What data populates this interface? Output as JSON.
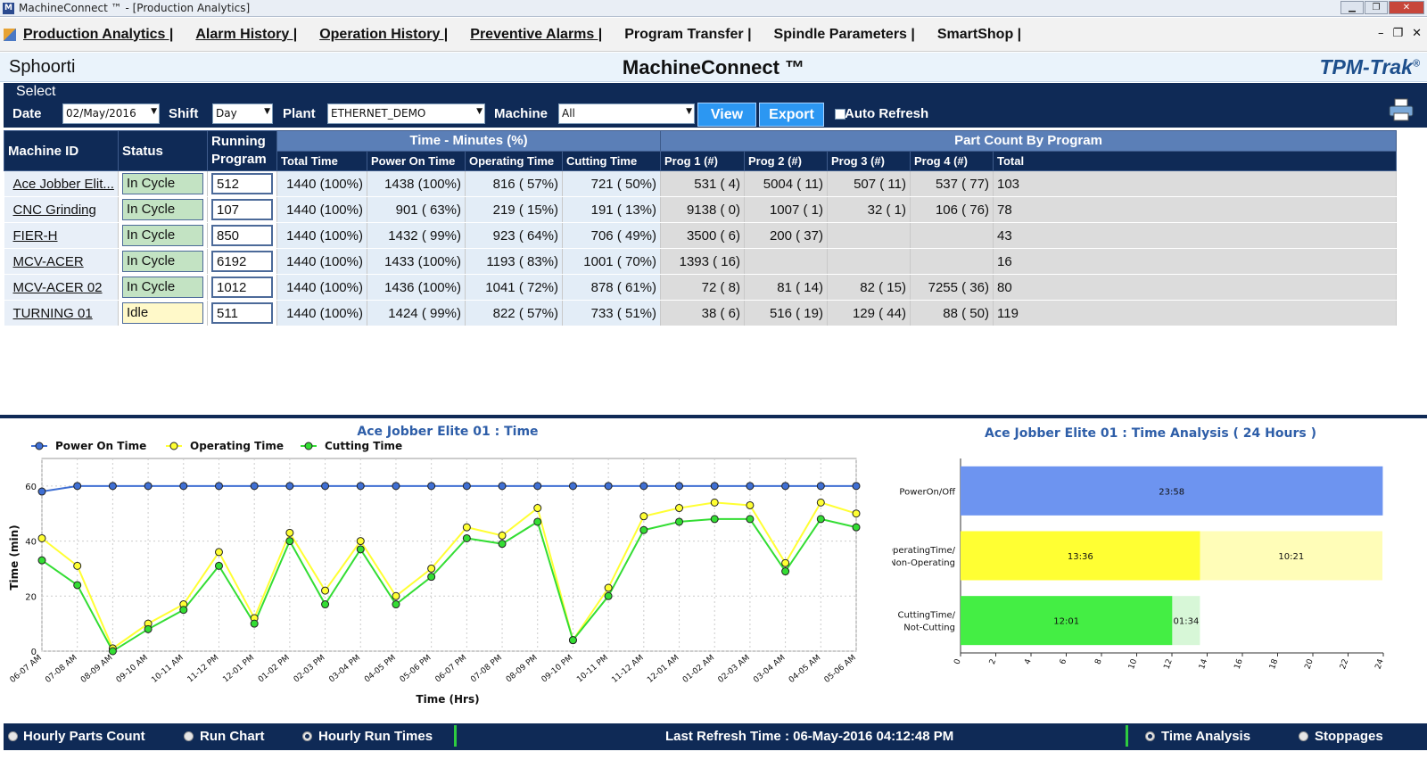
{
  "window": {
    "title": "MachineConnect ™ - [Production Analytics]",
    "app_icon_letter": "M",
    "min_label": "▁",
    "max_label": "❐",
    "close_label": "✕"
  },
  "menu": {
    "items": [
      "Production Analytics |",
      "Alarm History |",
      "Operation History |",
      "Preventive Alarms |",
      "Program Transfer |",
      "Spindle Parameters |",
      "SmartShop |"
    ],
    "mdi_min": "–",
    "mdi_restore": "❐",
    "mdi_close": "✕"
  },
  "header": {
    "company": "Sphoorti",
    "title": "MachineConnect ™",
    "brand": "TPM-Trak",
    "brand_reg": "®"
  },
  "select": {
    "legend": "Select",
    "date_label": "Date",
    "date_value": "02/May/2016",
    "shift_label": "Shift",
    "shift_value": "Day",
    "plant_label": "Plant",
    "plant_value": "ETHERNET_DEMO",
    "machine_label": "Machine",
    "machine_value": "All",
    "view_label": "View",
    "export_label": "Export",
    "auto_refresh_label": "Auto Refresh",
    "printer_icon": "printer-icon"
  },
  "table": {
    "headers": {
      "machine_id": "Machine ID",
      "status": "Status",
      "running_program_1": "Running",
      "running_program_2": "Program",
      "time_group": "Time - Minutes (%)",
      "part_group": "Part Count By Program",
      "total_time": "Total Time",
      "power_on": "Power On Time",
      "operating": "Operating Time",
      "cutting": "Cutting Time",
      "prog1": "Prog 1 (#)",
      "prog2": "Prog 2 (#)",
      "prog3": "Prog 3 (#)",
      "prog4": "Prog 4 (#)",
      "total": "Total"
    },
    "rows": [
      {
        "machine": "Ace Jobber Elit...",
        "status": "In Cycle",
        "program": "512",
        "total_time": "1440 (100%)",
        "power_on": "1438 (100%)",
        "operating": "816 ( 57%)",
        "cutting": "721 ( 50%)",
        "p1": "531 (  4)",
        "p2": "5004 ( 11)",
        "p3": "507 ( 11)",
        "p4": "537 ( 77)",
        "total": "103"
      },
      {
        "machine": "CNC Grinding",
        "status": "In Cycle",
        "program": "107",
        "total_time": "1440 (100%)",
        "power_on": "901 ( 63%)",
        "operating": "219 ( 15%)",
        "cutting": "191 ( 13%)",
        "p1": "9138 (  0)",
        "p2": "1007 (  1)",
        "p3": "32 (  1)",
        "p4": "106 ( 76)",
        "total": "78"
      },
      {
        "machine": "FIER-H",
        "status": "In Cycle",
        "program": "850",
        "total_time": "1440 (100%)",
        "power_on": "1432 ( 99%)",
        "operating": "923 ( 64%)",
        "cutting": "706 ( 49%)",
        "p1": "3500 (  6)",
        "p2": "200 ( 37)",
        "p3": "",
        "p4": "",
        "total": "43"
      },
      {
        "machine": "MCV-ACER",
        "status": "In Cycle",
        "program": "6192",
        "total_time": "1440 (100%)",
        "power_on": "1433 (100%)",
        "operating": "1193 ( 83%)",
        "cutting": "1001 ( 70%)",
        "p1": "1393 ( 16)",
        "p2": "",
        "p3": "",
        "p4": "",
        "total": "16"
      },
      {
        "machine": "MCV-ACER 02",
        "status": "In Cycle",
        "program": "1012",
        "total_time": "1440 (100%)",
        "power_on": "1436 (100%)",
        "operating": "1041 ( 72%)",
        "cutting": "878 ( 61%)",
        "p1": "72 (  8)",
        "p2": "81 ( 14)",
        "p3": "82 ( 15)",
        "p4": "7255 ( 36)",
        "total": "80"
      },
      {
        "machine": "TURNING 01",
        "status": "Idle",
        "program": "511",
        "total_time": "1440 (100%)",
        "power_on": "1424 ( 99%)",
        "operating": "822 ( 57%)",
        "cutting": "733 ( 51%)",
        "p1": "38 (  6)",
        "p2": "516 ( 19)",
        "p3": "129 ( 44)",
        "p4": "88 ( 50)",
        "total": "119"
      }
    ]
  },
  "chart_data": [
    {
      "type": "line",
      "title": "Ace Jobber Elite 01 : Time",
      "xlabel": "Time (Hrs)",
      "ylabel": "Time (min)",
      "ylim": [
        0,
        70
      ],
      "yticks": [
        0,
        20,
        40,
        60
      ],
      "grid": true,
      "legend_position": "top-left",
      "categories": [
        "06-07 AM",
        "07-08 AM",
        "08-09 AM",
        "09-10 AM",
        "10-11 AM",
        "11-12 PM",
        "12-01 PM",
        "01-02 PM",
        "02-03 PM",
        "03-04 PM",
        "04-05 PM",
        "05-06 PM",
        "06-07 PM",
        "07-08 PM",
        "08-09 PM",
        "09-10 PM",
        "10-11 PM",
        "11-12 AM",
        "12-01 AM",
        "01-02 AM",
        "02-03 AM",
        "03-04 AM",
        "04-05 AM",
        "05-06 AM"
      ],
      "series": [
        {
          "name": "Power On Time",
          "color": "#3f6fd3",
          "values": [
            58,
            60,
            60,
            60,
            60,
            60,
            60,
            60,
            60,
            60,
            60,
            60,
            60,
            60,
            60,
            60,
            60,
            60,
            60,
            60,
            60,
            60,
            60,
            60
          ]
        },
        {
          "name": "Operating Time",
          "color": "#ffff33",
          "values": [
            41,
            31,
            1,
            10,
            17,
            36,
            12,
            43,
            22,
            40,
            20,
            30,
            45,
            42,
            52,
            4,
            23,
            49,
            52,
            54,
            53,
            32,
            54,
            50
          ]
        },
        {
          "name": "Cutting Time",
          "color": "#33dd33",
          "values": [
            33,
            24,
            0,
            8,
            15,
            31,
            10,
            40,
            17,
            37,
            17,
            27,
            41,
            39,
            47,
            4,
            20,
            44,
            47,
            48,
            48,
            29,
            48,
            45
          ]
        }
      ]
    },
    {
      "type": "bar",
      "orientation": "horizontal",
      "stacked": true,
      "title": "Ace Jobber Elite 01 : Time Analysis ( 24 Hours )",
      "xlim": [
        0,
        24
      ],
      "xticks": [
        0,
        2,
        4,
        6,
        8,
        10,
        12,
        14,
        16,
        18,
        20,
        22,
        24
      ],
      "categories": [
        "PowerOn/Off",
        "OperatingTime/ Non-Operating",
        "CuttingTime/ Not-Cutting"
      ],
      "bars": [
        {
          "category": "PowerOn/Off",
          "segments": [
            {
              "value": 23.97,
              "label": "23:58",
              "color": "#6d94f0"
            }
          ]
        },
        {
          "category": "OperatingTime/ Non-Operating",
          "segments": [
            {
              "value": 13.6,
              "label": "13:36",
              "color": "#ffff33"
            },
            {
              "value": 10.35,
              "label": "10:21",
              "color": "#fffdb8"
            }
          ]
        },
        {
          "category": "CuttingTime/ Not-Cutting",
          "segments": [
            {
              "value": 12.02,
              "label": "12:01",
              "color": "#44ee44"
            },
            {
              "value": 1.57,
              "label": "01:34",
              "color": "#d7f7d7"
            }
          ]
        }
      ]
    }
  ],
  "statusbar": {
    "hourly_parts": "Hourly Parts Count",
    "run_chart": "Run Chart",
    "hourly_run_times": "Hourly Run Times",
    "last_refresh": "Last Refresh Time : 06-May-2016 04:12:48 PM",
    "time_analysis": "Time Analysis",
    "stoppages": "Stoppages"
  }
}
